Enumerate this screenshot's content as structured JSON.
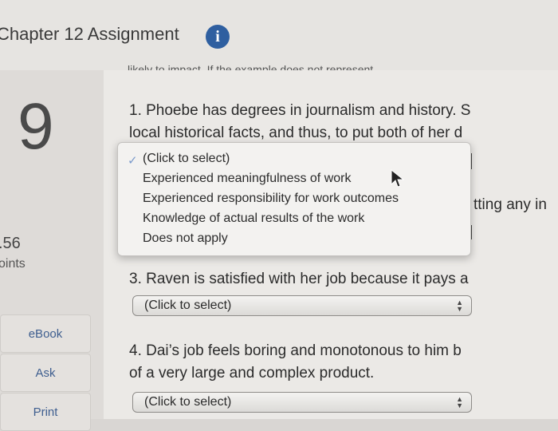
{
  "header": {
    "title": "Chapter 12 Assignment",
    "info_icon": "i"
  },
  "cut_text": "likely to impact. If the example does not represent",
  "sidebar": {
    "question_number": "9",
    "score": ".56",
    "points_label": "oints",
    "buttons": {
      "ebook": "eBook",
      "ask": "Ask",
      "print": "Print"
    }
  },
  "questions": {
    "q1": {
      "line1": "1. Phoebe has degrees in journalism and history. S",
      "line2": "local historical facts, and thus, to put both of her d"
    },
    "q2_partial": "tting any in",
    "q3": {
      "text": "3. Raven is satisfied with her job because it pays a"
    },
    "q4": {
      "line1": "4. Dai’s job feels boring and monotonous to him b",
      "line2": "of a very large and complex product."
    }
  },
  "dropdowns": {
    "placeholder": "(Click to select)",
    "options": [
      "(Click to select)",
      "Experienced meaningfulness of work",
      "Experienced responsibility for work outcomes",
      "Knowledge of actual results of the work",
      "Does not apply"
    ],
    "selected_index": 0
  },
  "colors": {
    "accent": "#2f5fa0",
    "link": "#3e5e8f"
  }
}
